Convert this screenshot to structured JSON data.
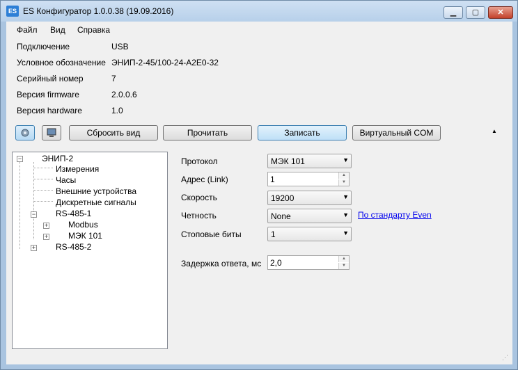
{
  "window": {
    "title": "ES Конфигуратор 1.0.0.38 (19.09.2016)"
  },
  "menu": [
    "Файл",
    "Вид",
    "Справка"
  ],
  "info": [
    {
      "label": "Подключение",
      "value": "USB"
    },
    {
      "label": "Условное обозначение",
      "value": "ЭНИП-2-45/100-24-А2Е0-32"
    },
    {
      "label": "Серийный номер",
      "value": "7"
    },
    {
      "label": "Версия firmware",
      "value": "2.0.0.6"
    },
    {
      "label": "Версия hardware",
      "value": "1.0"
    }
  ],
  "toolbar": {
    "reset_view": "Сбросить вид",
    "read": "Прочитать",
    "write": "Записать",
    "virtual_com": "Виртуальный COM"
  },
  "tree": {
    "root": "ЭНИП-2",
    "children": [
      "Измерения",
      "Часы",
      "Внешние устройства",
      "Дискретные сигналы",
      "RS-485-1",
      "RS-485-2"
    ],
    "rs485_1_children": [
      "Modbus",
      "МЭК 101"
    ]
  },
  "form": {
    "protocol_label": "Протокол",
    "protocol_value": "МЭК 101",
    "address_label": "Адрес (Link)",
    "address_value": "1",
    "speed_label": "Скорость",
    "speed_value": "19200",
    "parity_label": "Четность",
    "parity_value": "None",
    "parity_link": "По стандарту Even",
    "stopbits_label": "Стоповые биты",
    "stopbits_value": "1",
    "delay_label": "Задержка ответа, мс",
    "delay_value": "2,0"
  }
}
